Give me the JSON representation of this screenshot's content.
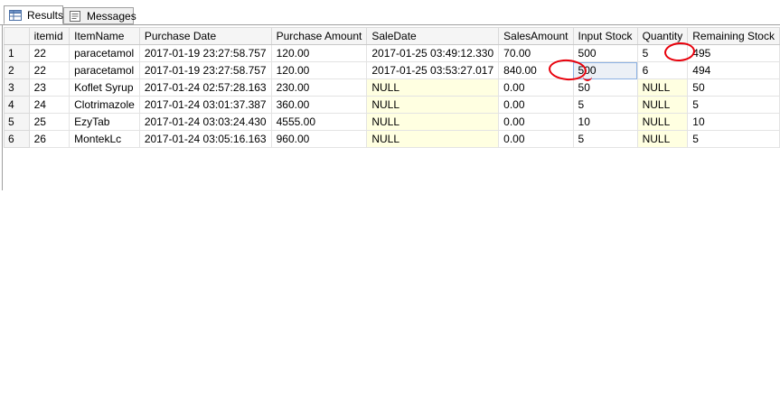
{
  "tabs": [
    {
      "label": "Results",
      "icon": "results-grid-icon",
      "active": true
    },
    {
      "label": "Messages",
      "icon": "messages-icon",
      "active": false
    }
  ],
  "grid": {
    "columns": [
      "itemid",
      "ItemName",
      "Purchase Date",
      "Purchase Amount",
      "SaleDate",
      "SalesAmount",
      "Input Stock",
      "Quantity",
      "Remaining Stock"
    ],
    "rows": [
      {
        "num": "1",
        "cells": [
          "22",
          "paracetamol",
          "2017-01-19 23:27:58.757",
          "120.00",
          "2017-01-25 03:49:12.330",
          "70.00",
          "500",
          "5",
          "495"
        ]
      },
      {
        "num": "2",
        "cells": [
          "22",
          "paracetamol",
          "2017-01-19 23:27:58.757",
          "120.00",
          "2017-01-25 03:53:27.017",
          "840.00",
          "500",
          "6",
          "494"
        ]
      },
      {
        "num": "3",
        "cells": [
          "23",
          "Koflet Syrup",
          "2017-01-24 02:57:28.163",
          "230.00",
          "NULL",
          "0.00",
          "50",
          "NULL",
          "50"
        ]
      },
      {
        "num": "4",
        "cells": [
          "24",
          "Clotrimazole",
          "2017-01-24 03:01:37.387",
          "360.00",
          "NULL",
          "0.00",
          "5",
          "NULL",
          "5"
        ]
      },
      {
        "num": "5",
        "cells": [
          "25",
          "EzyTab",
          "2017-01-24 03:03:24.430",
          "4555.00",
          "NULL",
          "0.00",
          "10",
          "NULL",
          "10"
        ]
      },
      {
        "num": "6",
        "cells": [
          "26",
          "MontekLc",
          "2017-01-24 03:05:16.163",
          "960.00",
          "NULL",
          "0.00",
          "5",
          "NULL",
          "5"
        ]
      }
    ]
  },
  "annotation_color": "#e8000b",
  "null_cell_color": "#ffffe1"
}
